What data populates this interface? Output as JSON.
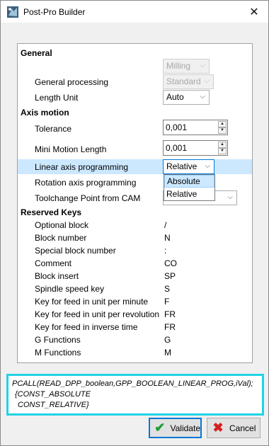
{
  "window": {
    "title": "Post-Pro Builder"
  },
  "sections": {
    "general": "General",
    "axis_motion": "Axis motion",
    "reserved_keys": "Reserved Keys"
  },
  "general": {
    "mode_value": "Milling",
    "general_processing_label": "General processing",
    "general_processing_value": "Standard",
    "length_unit_label": "Length Unit",
    "length_unit_value": "Auto"
  },
  "axis": {
    "tolerance_label": "Tolerance",
    "tolerance_value": "0,001",
    "mini_motion_label": "Mini Motion Length",
    "mini_motion_value": "0,001",
    "linear_label": "Linear axis programming",
    "linear_value": "Relative",
    "rotation_label": "Rotation axis programming",
    "toolchange_label": "Toolchange Point from CAM",
    "dropdown_options": [
      "Absolute",
      "Relative"
    ]
  },
  "keys": [
    {
      "label": "Optional block",
      "value": "/"
    },
    {
      "label": "Block number",
      "value": "N"
    },
    {
      "label": "Special block number",
      "value": ":"
    },
    {
      "label": "Comment",
      "value": "CO"
    },
    {
      "label": "Block insert",
      "value": "SP"
    },
    {
      "label": "Spindle speed key",
      "value": "S"
    },
    {
      "label": "Key for feed in unit per minute",
      "value": "F"
    },
    {
      "label": "Key for feed in unit per revolution",
      "value": "FR"
    },
    {
      "label": "Key for feed in inverse time",
      "value": "FR"
    },
    {
      "label": "G Functions",
      "value": "G"
    },
    {
      "label": "M Functions",
      "value": "M"
    }
  ],
  "code": {
    "line1": "PCALL(READ_DPP_boolean,GPP_BOOLEAN_LINEAR_PROG,iVal);",
    "line2": "{CONST_ABSOLUTE",
    "line3": "CONST_RELATIVE}"
  },
  "buttons": {
    "validate": "Validate",
    "cancel": "Cancel"
  },
  "colors": {
    "selection": "#cce8ff",
    "code_border": "#22d3e6",
    "validate_green": "#1a9e3a",
    "cancel_red": "#d42020"
  }
}
